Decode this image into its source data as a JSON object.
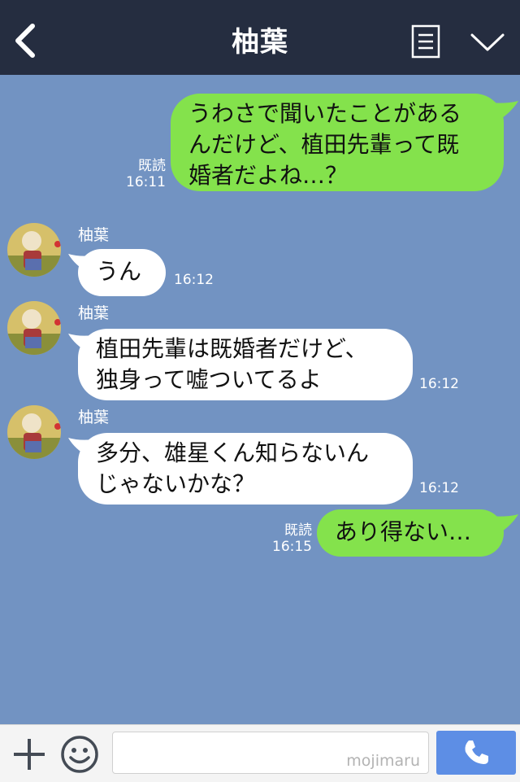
{
  "header": {
    "title": "柚葉",
    "back_icon": "chevron-left-icon",
    "menu_icon": "list-icon",
    "collapse_icon": "chevron-down-icon"
  },
  "colors": {
    "header_bg": "#252d40",
    "chat_bg": "#7293c2",
    "outgoing_bubble": "#84e24c",
    "incoming_bubble": "#ffffff",
    "call_button": "#5d8ee5"
  },
  "messages": [
    {
      "direction": "out",
      "lines": [
        "うわさで聞いたことがある",
        "んだけど、植田先輩って既",
        "婚者だよね…？"
      ],
      "read": "既読",
      "time": "16:11"
    },
    {
      "direction": "in",
      "sender": "柚葉",
      "lines": [
        "うん"
      ],
      "time": "16:12"
    },
    {
      "direction": "in",
      "sender": "柚葉",
      "lines": [
        "植田先輩は既婚者だけど、",
        "独身って嘘ついてるよ"
      ],
      "time": "16:12"
    },
    {
      "direction": "in",
      "sender": "柚葉",
      "lines": [
        "多分、雄星くん知らないん",
        "じゃないかな？"
      ],
      "time": "16:12"
    },
    {
      "direction": "out",
      "lines": [
        "あり得ない…"
      ],
      "read": "既読",
      "time": "16:15"
    }
  ],
  "footer": {
    "plus_icon": "plus-icon",
    "emoji_icon": "smiley-icon",
    "input_placeholder": "mojimaru",
    "call_icon": "phone-icon"
  }
}
